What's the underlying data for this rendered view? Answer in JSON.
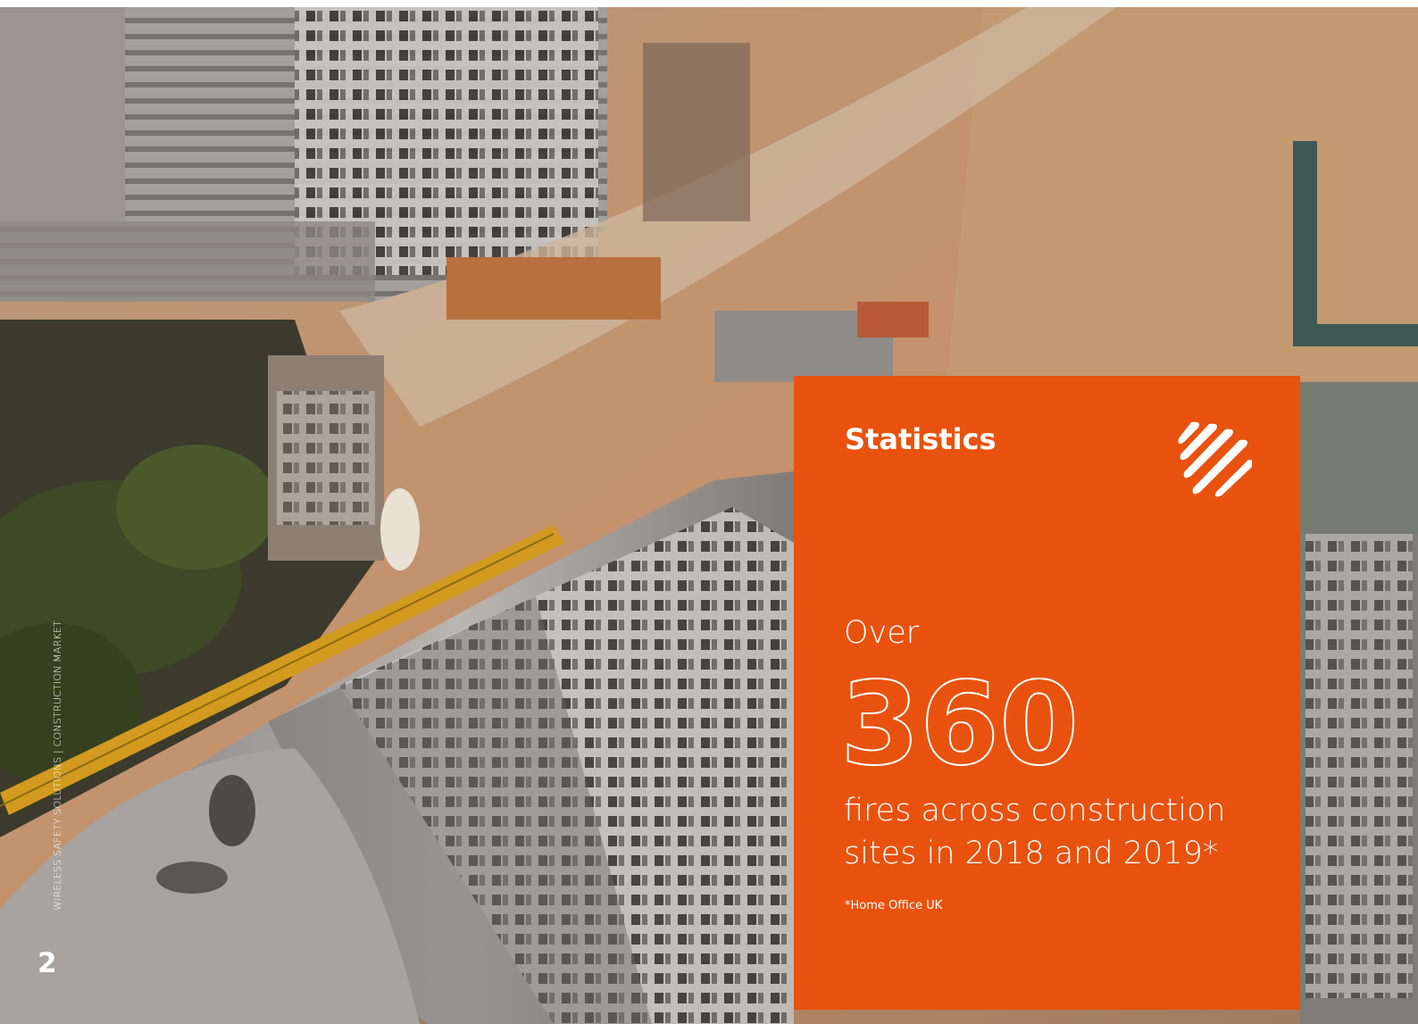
{
  "side_caption": "WIRELESS SAFETY SOLUTIONS | CONSTRUCTION MARKET",
  "page_number": "2",
  "stats": {
    "heading": "Statistics",
    "prefix": "Over",
    "number": "360",
    "description": "fires across construction sites in 2018 and 2019*",
    "source": "*Home Office UK"
  },
  "colors": {
    "panel": "#e8520e",
    "text": "#ffffff"
  },
  "icons": {
    "brand_mark": "diagonal-stripes-logo"
  }
}
